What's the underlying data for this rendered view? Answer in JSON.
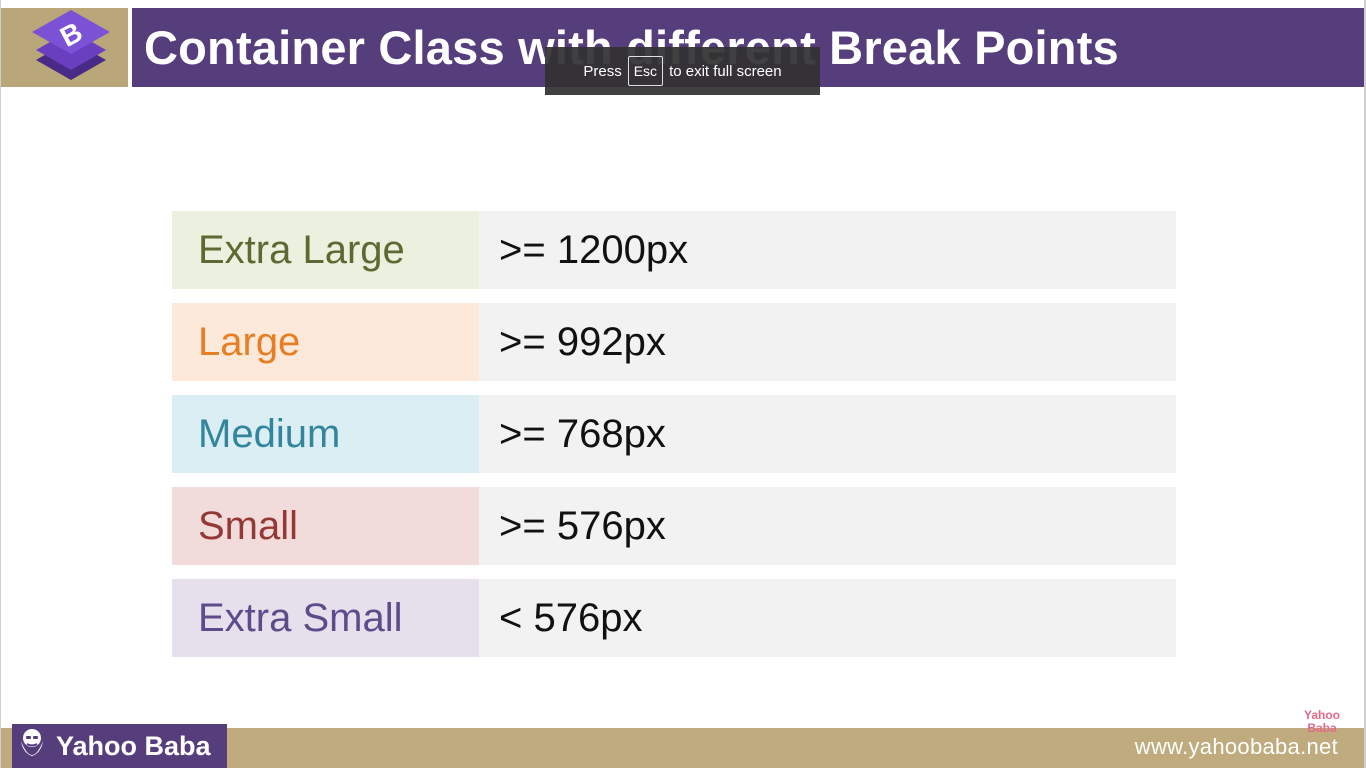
{
  "slide": {
    "title": "Container Class with different Break Points",
    "logo_letter": "B"
  },
  "fullscreen_notice": {
    "prefix": "Press",
    "key": "Esc",
    "suffix": "to exit full screen"
  },
  "breakpoints": [
    {
      "label": "Extra Large",
      "value": ">= 1200px",
      "label_color": "#5b6a33",
      "label_bg": "#ebf1de"
    },
    {
      "label": "Large",
      "value": ">= 992px",
      "label_color": "#e77e23",
      "label_bg": "#fde9d9"
    },
    {
      "label": "Medium",
      "value": ">= 768px",
      "label_color": "#31859c",
      "label_bg": "#dbeef4"
    },
    {
      "label": "Small",
      "value": ">= 576px",
      "label_color": "#953735",
      "label_bg": "#f2dcdb"
    },
    {
      "label": "Extra Small",
      "value": "< 576px",
      "label_color": "#5f4b8b",
      "label_bg": "#e5e0ec"
    }
  ],
  "footer": {
    "brand": "Yahoo Baba",
    "url": "www.yahoobaba.net",
    "watermark_line1": "Yahoo",
    "watermark_line2": "Baba"
  },
  "colors": {
    "header_purple": "#563d7c",
    "header_tan": "#b9a77a",
    "value_bg": "#f2f2f2"
  }
}
